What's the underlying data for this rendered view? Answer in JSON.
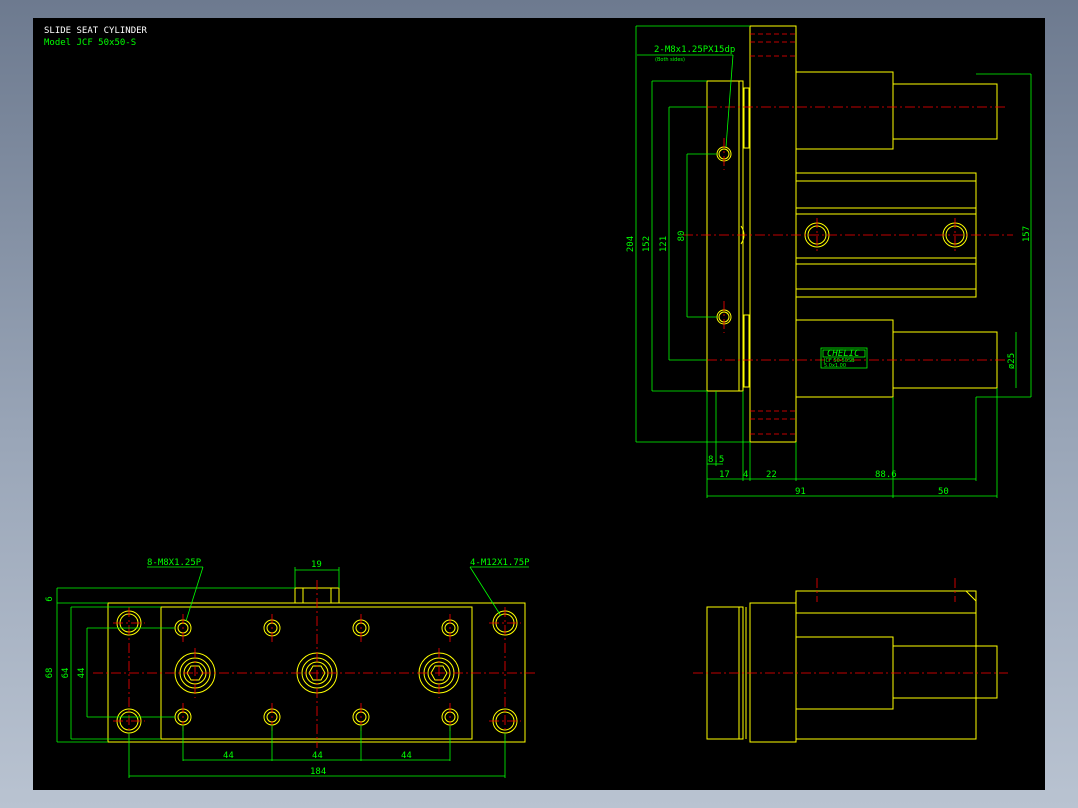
{
  "title": {
    "line1": "SLIDE SEAT CYLINDER",
    "line2": "Model  JCF 50x50-S"
  },
  "callouts": {
    "side_tap": "2-M8x1.25PX15dp",
    "side_tap_note": "(Both sides)",
    "front_tap_small": "8-M8X1.25P",
    "front_tap_large": "4-M12X1.75P"
  },
  "brand": {
    "logo": "CHELIC",
    "plate_line1": "JCF 50-50SB",
    "plate_line2": "5.0x1.00"
  },
  "side_view_dims": {
    "overall_height": "204",
    "mount_height": "152",
    "hole_pitch_outer": "121",
    "hole_pitch_inner": "80",
    "rod_length": "157",
    "rod_dia": "ø25",
    "offset_8_5": "8.5",
    "flange_17": "17",
    "gap_4": "4",
    "body_22": "22",
    "body_88_6": "88.6",
    "len_91": "91",
    "stroke_50": "50"
  },
  "front_view_dims": {
    "key_width": "19",
    "top_6": "6",
    "height_68": "68",
    "pitch_64": "64",
    "pitch_44_v": "44",
    "pitch_44_a": "44",
    "pitch_44_b": "44",
    "pitch_44_c": "44",
    "overall_184": "184"
  },
  "colors": {
    "background": "#000000",
    "outline": "#ffff00",
    "dimension": "#00ff00",
    "centerline": "#ff0000",
    "text": "#ffffff"
  }
}
